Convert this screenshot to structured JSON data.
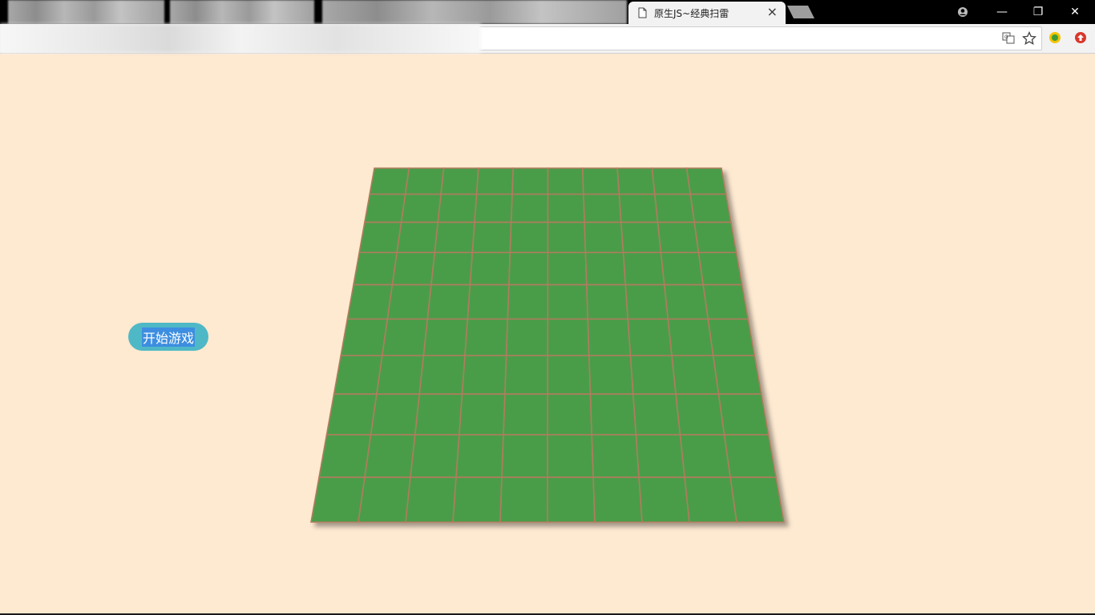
{
  "browser": {
    "tab_title": "原生JS~经典扫雷",
    "tab_close": "×",
    "window_buttons": {
      "minimize": "—",
      "restore": "❐",
      "close": "✕"
    }
  },
  "game": {
    "start_button_label": "开始游戏",
    "board": {
      "rows": 10,
      "cols": 10
    },
    "colors": {
      "background": "#fee9d1",
      "cell_fill": "#4a9d49",
      "cell_border": "#b07c5e",
      "button": "#4fb8c6"
    }
  }
}
